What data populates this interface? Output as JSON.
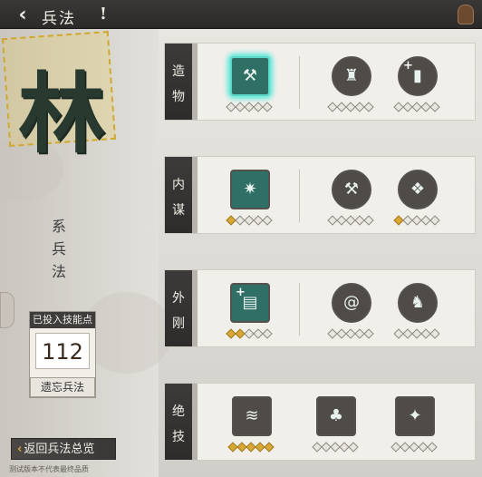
{
  "header": {
    "title": "兵法",
    "back_icon": "back-arrow-icon",
    "help_icon": "exclamation-icon",
    "bag_icon": "pouch-icon"
  },
  "school": {
    "name": "林",
    "suffix_chars": [
      "系",
      "兵",
      "法"
    ]
  },
  "points": {
    "label": "已投入技能点",
    "value": "112",
    "forget_label": "遗忘兵法"
  },
  "return_label": "返回兵法总览",
  "footnote": "测试版本不代表最终品质",
  "colors": {
    "highlight": "#5ce8d9",
    "star_on": "#d9a733",
    "label_bg": "#3d3b39",
    "seal": "#cfa832"
  },
  "rows": [
    {
      "name": "造物",
      "chars": [
        "造",
        "物"
      ],
      "skills": [
        {
          "icon": "craft-tool-icon",
          "shape": "square",
          "level": 0,
          "max": 5,
          "selected": true
        },
        {
          "icon": "scarecrow-icon",
          "shape": "round",
          "level": 0,
          "max": 5,
          "selected": false
        },
        {
          "icon": "plus-tablet-icon",
          "shape": "round",
          "level": 0,
          "max": 5,
          "selected": false
        }
      ]
    },
    {
      "name": "内谋",
      "chars": [
        "内",
        "谋"
      ],
      "skills": [
        {
          "icon": "swirl-star-icon",
          "shape": "square",
          "level": 1,
          "max": 5,
          "selected": false
        },
        {
          "icon": "hammer-icon",
          "shape": "round",
          "level": 0,
          "max": 5,
          "selected": false
        },
        {
          "icon": "stamp-icon",
          "shape": "round",
          "level": 1,
          "max": 5,
          "selected": false
        }
      ]
    },
    {
      "name": "外刚",
      "chars": [
        "外",
        "刚"
      ],
      "skills": [
        {
          "icon": "plus-scroll-icon",
          "shape": "square",
          "level": 2,
          "max": 5,
          "selected": false
        },
        {
          "icon": "whirlwind-icon",
          "shape": "round",
          "level": 0,
          "max": 5,
          "selected": false
        },
        {
          "icon": "warriors-icon",
          "shape": "round",
          "level": 0,
          "max": 5,
          "selected": false
        }
      ]
    },
    {
      "name": "绝技",
      "chars": [
        "绝",
        "技"
      ],
      "skills": [
        {
          "icon": "wave-horse-icon",
          "shape": "square",
          "level": 5,
          "max": 5,
          "selected": false
        },
        {
          "icon": "forest-icon",
          "shape": "square",
          "level": 0,
          "max": 5,
          "selected": false
        },
        {
          "icon": "warrior-leap-icon",
          "shape": "square",
          "level": 0,
          "max": 5,
          "selected": false
        }
      ]
    }
  ]
}
